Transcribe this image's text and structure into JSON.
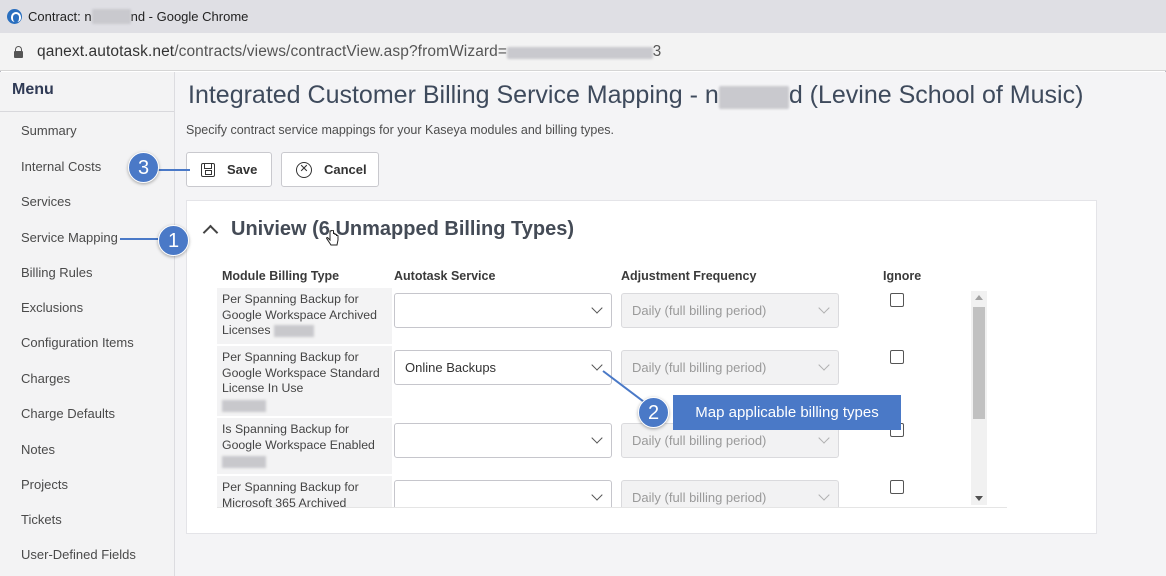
{
  "window": {
    "title_prefix": "Contract: n",
    "title_redacted": "xxxxxx",
    "title_suffix": "nd - Google Chrome"
  },
  "address": {
    "host": "qanext.autotask.net",
    "path": "/contracts/views/contractView.asp?fromWizard=",
    "redacted": "xxxxxxxxxxxxxxxxxxxxxxxxxx",
    "tail": "3"
  },
  "sidebar": {
    "title": "Menu",
    "items": [
      {
        "label": "Summary"
      },
      {
        "label": "Internal Costs"
      },
      {
        "label": "Services"
      },
      {
        "label": "Service Mapping"
      },
      {
        "label": "Billing Rules"
      },
      {
        "label": "Exclusions"
      },
      {
        "label": "Configuration Items"
      },
      {
        "label": "Charges"
      },
      {
        "label": "Charge Defaults"
      },
      {
        "label": "Notes"
      },
      {
        "label": "Projects"
      },
      {
        "label": "Tickets"
      },
      {
        "label": "User-Defined Fields"
      }
    ]
  },
  "page": {
    "title_prefix": "Integrated Customer Billing Service Mapping - n",
    "title_redacted": "xxxxxxx",
    "title_suffix": "d (Levine School of Music)",
    "subtitle": "Specify contract service mappings for your Kaseya modules and billing types."
  },
  "toolbar": {
    "save_label": "Save",
    "cancel_label": "Cancel"
  },
  "section": {
    "title": "Uniview (6 Unmapped Billing Types)"
  },
  "table": {
    "headers": [
      "Module Billing Type",
      "Autotask Service",
      "Adjustment Frequency",
      "Ignore"
    ],
    "rows": [
      {
        "billing_type": "Per Spanning Backup for Google Workspace Archived Licenses",
        "service": "",
        "frequency": "Daily (full billing period)",
        "ignore": false
      },
      {
        "billing_type": "Per Spanning Backup for Google Workspace Standard License In Use",
        "service": "Online Backups",
        "frequency": "Daily (full billing period)",
        "ignore": false
      },
      {
        "billing_type": "Is Spanning Backup for Google Workspace Enabled",
        "service": "",
        "frequency": "Daily (full billing period)",
        "ignore": false
      },
      {
        "billing_type": "Per Spanning Backup for Microsoft 365 Archived",
        "service": "",
        "frequency": "Daily (full billing period)",
        "ignore": false
      }
    ]
  },
  "callouts": [
    {
      "number": "1"
    },
    {
      "number": "2",
      "label": "Map applicable billing types"
    },
    {
      "number": "3"
    }
  ],
  "colors": {
    "accent": "#4a79c7",
    "title_text": "#3e4a5c"
  }
}
